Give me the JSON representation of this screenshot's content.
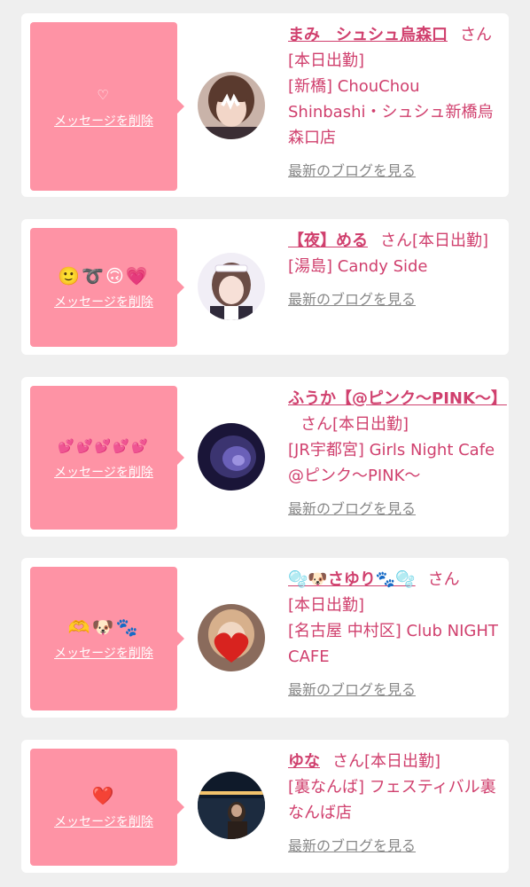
{
  "colors": {
    "background": "#efefef",
    "card": "#ffffff",
    "bubble": "#fe93a5",
    "accent": "#d0406e",
    "link_gray": "#888888"
  },
  "delete_label": "メッセージを削除",
  "blog_label": "最新のブログを見る",
  "items": [
    {
      "message": "♡",
      "name": "まみ　シュシュ烏森口",
      "honorific": "さん",
      "status": "[本日出勤]",
      "shop": "[新橋] ChouChou Shinbashi・シュシュ新橋烏森口店",
      "avatar": "girl-peace-sign-photo"
    },
    {
      "message": "🙂➰🙃💗",
      "name": "【夜】める",
      "honorific": "さん",
      "status": "[本日出勤]",
      "shop": "[湯島] Candy Side",
      "avatar": "maid-costume-photo"
    },
    {
      "message": "💕💕💕💕💕",
      "name": "ふうか【@ピンク〜PINK〜】",
      "honorific": "さん",
      "status": "[本日出勤]",
      "shop": "[JR宇都宮] Girls Night Cafe @ピンク〜PINK〜",
      "avatar": "dark-blue-photo"
    },
    {
      "message": "🫶🐶🐾",
      "name": "🫧🐶さゆり🐾🫧",
      "honorific": "さん",
      "status": "[本日出勤]",
      "shop": "[名古屋 中村区] Club NIGHT CAFE",
      "avatar": "heart-covered-face-photo"
    },
    {
      "message": "❤️",
      "name": "ゆな",
      "honorific": "さん",
      "status": "[本日出勤]",
      "shop": "[裏なんば] フェスティバル裏なんば店",
      "avatar": "night-river-photo"
    }
  ]
}
